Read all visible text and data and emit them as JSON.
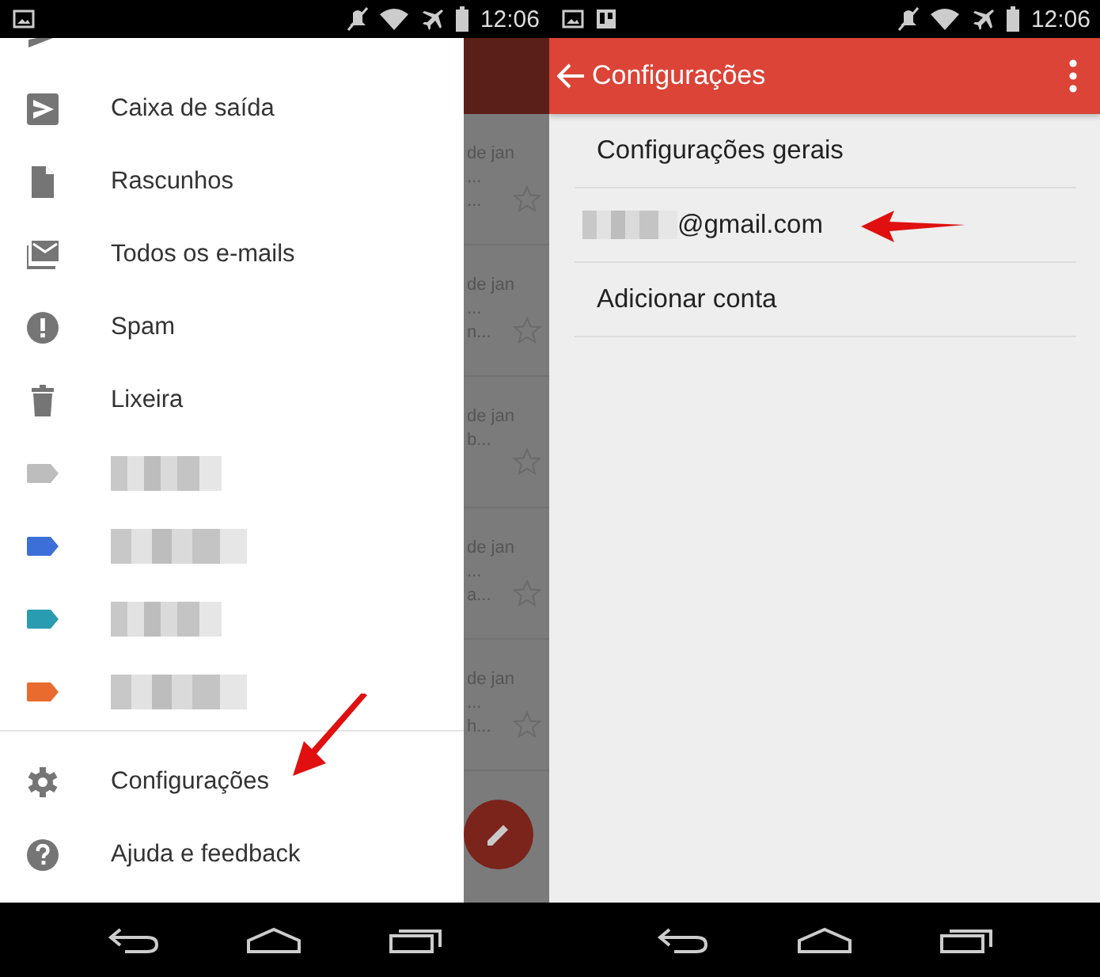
{
  "left_screen": {
    "status_bar": {
      "notifications": [
        {
          "kind": "image"
        }
      ],
      "time": "12:06"
    },
    "drawer": {
      "items": [
        {
          "kind": "sent"
        },
        {
          "kind": "outbox",
          "label": "Caixa de saída"
        },
        {
          "kind": "draft",
          "label": "Rascunhos"
        },
        {
          "kind": "all_mail",
          "label": "Todos os e-mails"
        },
        {
          "kind": "spam",
          "label": "Spam"
        },
        {
          "kind": "trash",
          "label": "Lixeira"
        },
        {
          "kind": "label",
          "color": "#bdbdbd"
        },
        {
          "kind": "label",
          "color": "#3d6fd9"
        },
        {
          "kind": "label",
          "color": "#2a9cb1"
        },
        {
          "kind": "label",
          "color": "#e96b2d"
        }
      ],
      "footer_items": [
        {
          "kind": "settings",
          "label": "Configurações"
        },
        {
          "kind": "help",
          "label": "Ajuda e feedback"
        }
      ]
    },
    "mail_list": {
      "rows": [
        {
          "date": "de jan",
          "lines": [
            "...",
            "..."
          ]
        },
        {
          "date": "de jan",
          "lines": [
            "...",
            "n..."
          ]
        },
        {
          "date": "de jan",
          "lines": [
            "b..."
          ]
        },
        {
          "date": "de jan",
          "lines": [
            "...",
            "a..."
          ]
        },
        {
          "date": "de jan",
          "lines": [
            "...",
            "h..."
          ]
        }
      ]
    }
  },
  "right_screen": {
    "status_bar": {
      "notifications": [
        {
          "kind": "image"
        },
        {
          "kind": "board"
        }
      ],
      "time": "12:06"
    },
    "toolbar": {
      "title": "Configurações"
    },
    "rows": [
      {
        "kind": "text",
        "label": "Configurações gerais"
      },
      {
        "kind": "account",
        "label": "@gmail.com"
      },
      {
        "kind": "text",
        "label": "Adicionar conta"
      }
    ]
  }
}
